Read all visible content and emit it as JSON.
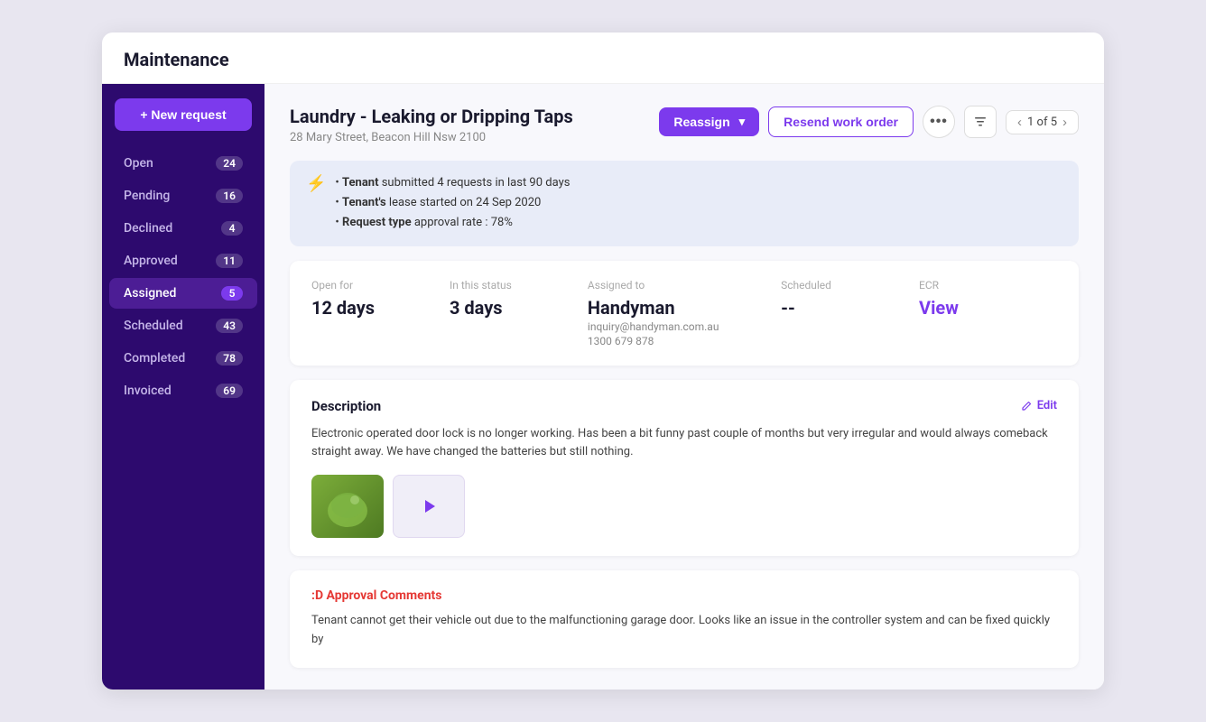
{
  "app": {
    "title": "Maintenance"
  },
  "sidebar": {
    "new_request_label": "+ New request",
    "items": [
      {
        "id": "open",
        "label": "Open",
        "count": "24",
        "active": false
      },
      {
        "id": "pending",
        "label": "Pending",
        "count": "16",
        "active": false
      },
      {
        "id": "declined",
        "label": "Declined",
        "count": "4",
        "active": false
      },
      {
        "id": "approved",
        "label": "Approved",
        "count": "11",
        "active": false
      },
      {
        "id": "assigned",
        "label": "Assigned",
        "count": "5",
        "active": true
      },
      {
        "id": "scheduled",
        "label": "Scheduled",
        "count": "43",
        "active": false
      },
      {
        "id": "completed",
        "label": "Completed",
        "count": "78",
        "active": false
      },
      {
        "id": "invoiced",
        "label": "Invoiced",
        "count": "69",
        "active": false
      }
    ]
  },
  "header": {
    "title": "Laundry - Leaking or Dripping Taps",
    "address": "28 Mary Street, Beacon Hill Nsw 2100",
    "reassign_label": "Reassign",
    "resend_label": "Resend work order",
    "more_label": "...",
    "pagination": {
      "current": "1",
      "total": "5",
      "text": "1 of 5"
    }
  },
  "info_banner": {
    "line1_bold": "Tenant",
    "line1_text": " submitted 4 requests in last 90 days",
    "line2_bold": "Tenant's",
    "line2_text": " lease started on 24 Sep 2020",
    "line3_bold": "Request type",
    "line3_text": " approval rate : 78%"
  },
  "status": {
    "open_for_label": "Open for",
    "open_for_value": "12 days",
    "in_status_label": "In this status",
    "in_status_value": "3 days",
    "assigned_to_label": "Assigned to",
    "assigned_to_value": "Handyman",
    "assigned_to_email": "inquiry@handyman.com.au",
    "assigned_to_phone": "1300 679 878",
    "scheduled_label": "Scheduled",
    "scheduled_value": "--",
    "ecr_label": "ECR",
    "ecr_value": "View"
  },
  "description": {
    "title": "Description",
    "edit_label": "Edit",
    "body": "Electronic operated door lock is no longer working. Has been a bit funny past couple of months but very irregular and would always comeback straight away. We have changed the batteries but still nothing."
  },
  "approval": {
    "title": ":D Approval Comments",
    "body": "Tenant cannot get their vehicle out due to the malfunctioning garage door. Looks like an issue in the controller system and can be fixed quickly by"
  }
}
